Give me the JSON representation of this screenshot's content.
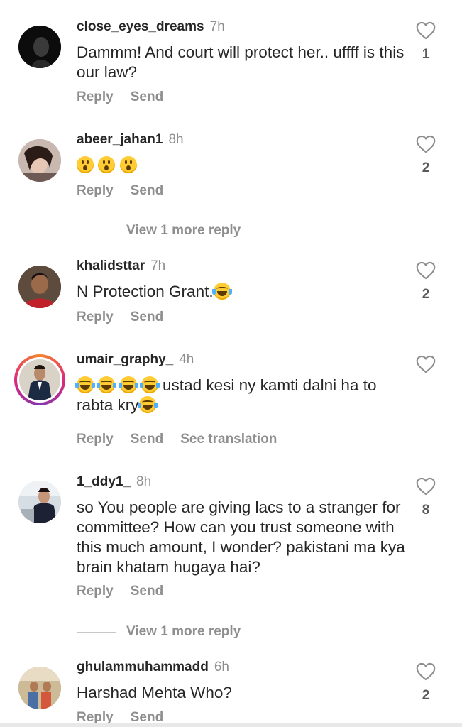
{
  "actions": {
    "reply": "Reply",
    "send": "Send",
    "see_translation": "See translation"
  },
  "comments": [
    {
      "username": "close_eyes_dreams",
      "time": "7h",
      "text": "Dammm! And court will protect her.. uffff is this our law?",
      "likes": "1"
    },
    {
      "username": "abeer_jahan1",
      "time": "8h",
      "text": "",
      "likes": "2"
    },
    {
      "username": "khalidsttar",
      "time": "7h",
      "text": "N Protection Grant.",
      "likes": "2"
    },
    {
      "username": "umair_graphy_",
      "time": "4h",
      "text_line1": " ustad kesi ny kamti dalni ha to",
      "text_line2": "rabta kry",
      "likes": ""
    },
    {
      "username": "1_ddy1_",
      "time": "8h",
      "text": "so You people are giving lacs to a stranger for committee? How can you trust someone with this much amount, I wonder? pakistani ma kya brain khatam hugaya hai?",
      "likes": "8"
    },
    {
      "username": "ghulammuhammadd",
      "time": "6h",
      "text": "Harshad Mehta Who?",
      "likes": "2"
    }
  ],
  "view_more": [
    "View 1 more reply",
    "View 1 more reply"
  ],
  "icons": {
    "like": "heart-outline-icon",
    "emoji_wow": "astonished-face-emoji",
    "emoji_laugh": "tears-of-joy-emoji"
  }
}
